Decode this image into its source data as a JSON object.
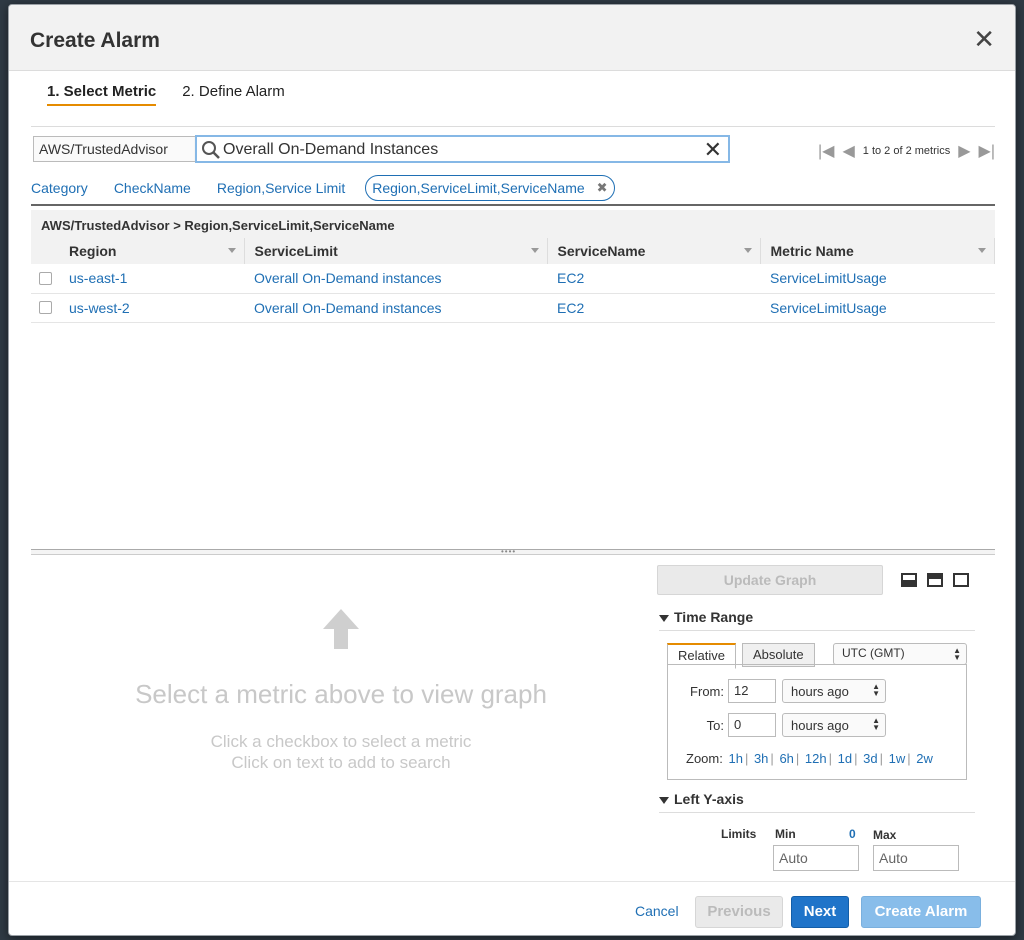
{
  "modal": {
    "title": "Create Alarm",
    "close": "✕"
  },
  "wizard": {
    "steps": [
      "1. Select Metric",
      "2. Define Alarm"
    ]
  },
  "filter": {
    "namespace": "AWS/TrustedAdvisor",
    "search_value": "Overall On-Demand Instances",
    "pager_text": "1 to 2 of 2 metrics"
  },
  "crumbs": [
    "Category",
    "CheckName",
    "Region,Service Limit",
    "Region,ServiceLimit,ServiceName"
  ],
  "table": {
    "caption": "AWS/TrustedAdvisor > Region,ServiceLimit,ServiceName",
    "columns": [
      "Region",
      "ServiceLimit",
      "ServiceName",
      "Metric Name"
    ],
    "rows": [
      [
        "us-east-1",
        "Overall On-Demand instances",
        "EC2",
        "ServiceLimitUsage"
      ],
      [
        "us-west-2",
        "Overall On-Demand instances",
        "EC2",
        "ServiceLimitUsage"
      ]
    ]
  },
  "graph_placeholder": {
    "main": "Select a metric above to view graph",
    "line1": "Click a checkbox to select a metric",
    "line2": "Click on text to add to search"
  },
  "right_panel": {
    "update_label": "Update Graph",
    "time_range_title": "Time Range",
    "tabs": [
      "Relative",
      "Absolute"
    ],
    "timezone": "UTC (GMT)",
    "from_label": "From:",
    "from_value": "12",
    "from_unit": "hours ago",
    "to_label": "To:",
    "to_value": "0",
    "to_unit": "hours ago",
    "zoom_label": "Zoom:",
    "zoom_options": [
      "1h",
      "3h",
      "6h",
      "12h",
      "1d",
      "3d",
      "1w",
      "2w"
    ],
    "y_axis_title": "Left Y-axis",
    "limits_label": "Limits",
    "min_label": "Min",
    "min_value_link": "0",
    "max_label": "Max",
    "min_placeholder": "Auto",
    "max_placeholder": "Auto"
  },
  "footer": {
    "cancel": "Cancel",
    "previous": "Previous",
    "next": "Next",
    "create": "Create Alarm"
  },
  "colors": {
    "link": "#1f6fb4",
    "accent": "#e58b00",
    "primary": "#1f74c9"
  }
}
